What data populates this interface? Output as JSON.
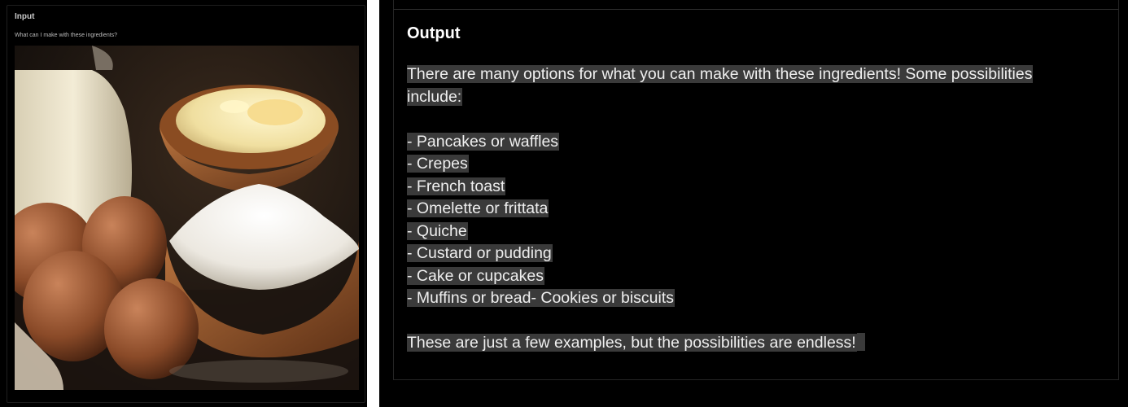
{
  "input": {
    "title": "Input",
    "prompt": "What can I make with these ingredients?",
    "image_alt": "Milk jug, bowl of melted butter with egg yolk, bowl of flour and brown eggs on a dark wooden surface"
  },
  "output": {
    "title": "Output",
    "intro": "There are many options for what you can make with these ingredients! Some possibilities include:",
    "items": [
      "- Pancakes or waffles",
      "- Crepes",
      "- French toast",
      "- Omelette or frittata",
      "- Quiche",
      "- Custard or pudding",
      "- Cake or cupcakes",
      "- Muffins or bread- Cookies or biscuits"
    ],
    "closing": "These are just a few examples, but the possibilities are endless!"
  }
}
